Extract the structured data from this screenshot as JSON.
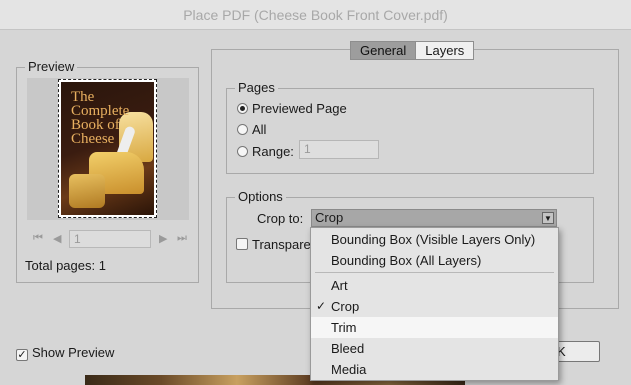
{
  "window": {
    "title": "Place PDF (Cheese Book Front Cover.pdf)"
  },
  "preview": {
    "group_label": "Preview",
    "thumbnail_title": "The Complete Book of Cheese",
    "page_number": "1",
    "total_pages": "Total pages: 1",
    "first_icon": "first-page-icon",
    "prev_icon": "prev-page-icon",
    "next_icon": "next-page-icon",
    "last_icon": "last-page-icon"
  },
  "show_preview": {
    "label": "Show Preview",
    "checked": true
  },
  "tabs": [
    {
      "label": "General",
      "active": true
    },
    {
      "label": "Layers",
      "active": false
    }
  ],
  "pages": {
    "group_label": "Pages",
    "options": [
      {
        "label": "Previewed Page",
        "selected": true
      },
      {
        "label": "All",
        "selected": false
      },
      {
        "label": "Range:",
        "selected": false
      }
    ],
    "range_value": "1"
  },
  "options": {
    "group_label": "Options",
    "crop_label": "Crop to:",
    "crop_value": "Crop",
    "transparent_label": "Transpare"
  },
  "ok_button": {
    "label": "K"
  },
  "dropdown": {
    "items": [
      {
        "label": "Bounding Box (Visible Layers Only)",
        "checked": false
      },
      {
        "label": "Bounding Box (All Layers)",
        "checked": false
      },
      {
        "label": "Art",
        "checked": false
      },
      {
        "label": "Crop",
        "checked": true
      },
      {
        "label": "Trim",
        "checked": false,
        "hovered": true
      },
      {
        "label": "Bleed",
        "checked": false
      },
      {
        "label": "Media",
        "checked": false
      }
    ],
    "check_glyph": "✓"
  }
}
